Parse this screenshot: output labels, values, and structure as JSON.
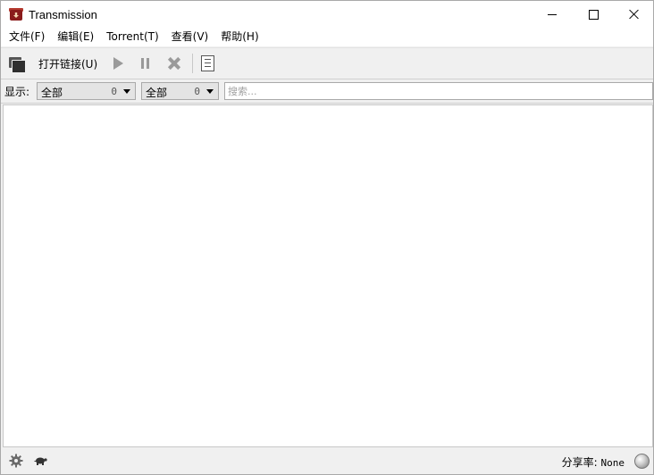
{
  "window": {
    "title": "Transmission"
  },
  "menu": [
    {
      "label": "文件(F)"
    },
    {
      "label": "编辑(E)"
    },
    {
      "label": "Torrent(T)"
    },
    {
      "label": "查看(V)"
    },
    {
      "label": "帮助(H)"
    }
  ],
  "toolbar": {
    "open_link_label": "打开链接(U)"
  },
  "filter": {
    "show_label": "显示:",
    "activity": {
      "value": "全部",
      "count": "0"
    },
    "tracker": {
      "value": "全部",
      "count": "0"
    },
    "search_placeholder": "搜索..."
  },
  "status": {
    "ratio_label": "分享率:",
    "ratio_value": "None"
  },
  "colors": {
    "background": "#f0f0f0",
    "list_background": "#ffffff",
    "disabled_icon": "#9a9a9a"
  }
}
